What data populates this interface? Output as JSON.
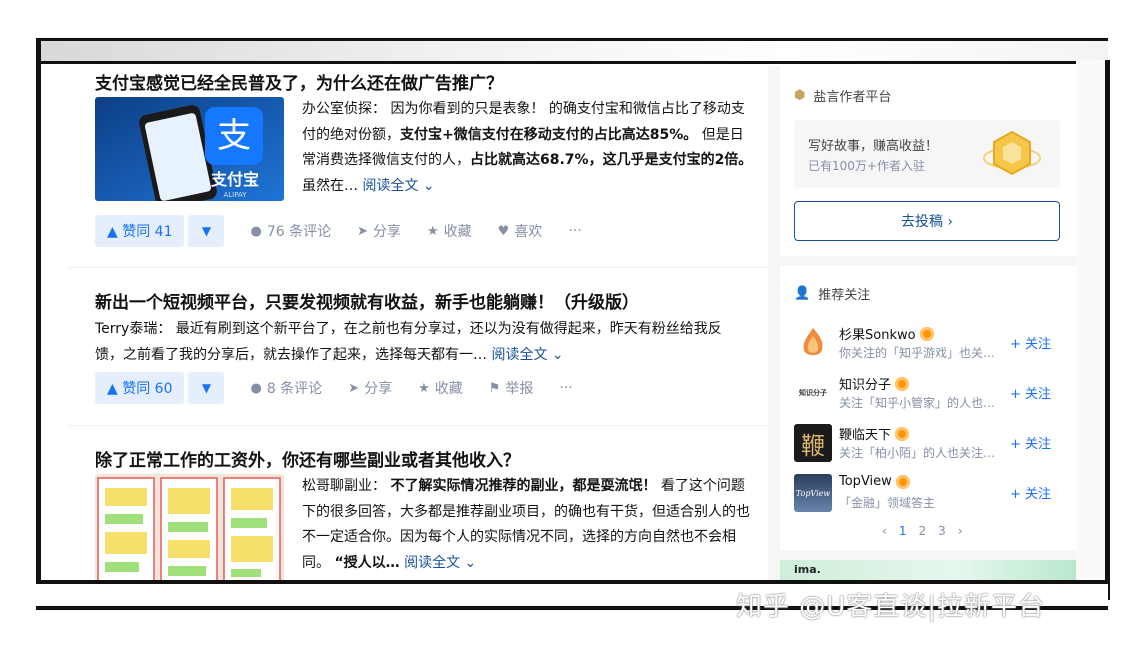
{
  "feed": {
    "cards": [
      {
        "title": "支付宝感觉已经全民普及了，为什么还在做广告推广？",
        "author": "办公室侦探：",
        "excerpt_parts": [
          "因为你看到的只是表象！ 的确支付宝和微信占比了移动支付的绝对份额，",
          "支付宝+微信支付在移动支付的占比高达85%。",
          " 但是日常消费选择微信支付的人，",
          "占比就高达68.7%，这几乎是支付宝的2倍。",
          " 虽然在…"
        ],
        "read_more": "阅读全文 ⌄",
        "thumb_text": "支付宝",
        "thumb_sub": "ALIPAY",
        "upvote": "▲ 赞同 41",
        "downvote": "▼",
        "comments": "76 条评论",
        "share": "分享",
        "favorite": "收藏",
        "like": "喜欢",
        "more": "···"
      },
      {
        "title": "新出一个短视频平台，只要发视频就有收益，新手也能躺赚！（升级版）",
        "author": "Terry泰瑞：",
        "excerpt": "最近有刷到这个新平台了，在之前也有分享过，还以为没有做得起来，昨天有粉丝给我反馈，之前看了我的分享后，就去操作了起来，选择每天都有一…",
        "read_more": "阅读全文 ⌄",
        "upvote": "▲ 赞同 60",
        "downvote": "▼",
        "comments": "8 条评论",
        "share": "分享",
        "favorite": "收藏",
        "report": "举报",
        "more": "···"
      },
      {
        "title": "除了正常工作的工资外，你还有哪些副业或者其他收入？",
        "author": "松哥聊副业：",
        "excerpt_parts": [
          "不了解实际情况推荐的副业，都是耍流氓！",
          " 看了这个问题下的很多回答，大多都是推荐副业项目，的确也有干货，但适合别人的也不一定适合你。因为每个人的实际情况不同，选择的方向自然也不会相同。 ",
          "“授人以…"
        ],
        "read_more": "阅读全文 ⌄"
      }
    ]
  },
  "sidebar": {
    "creator": {
      "title": "盐言作者平台",
      "promo_title": "写好故事，赚高收益！",
      "promo_sub": "已有100万+作者入驻",
      "submit": "去投稿 ›"
    },
    "recommend": {
      "title": "推荐关注",
      "items": [
        {
          "name": "杉果Sonkwo",
          "desc": "你关注的「知乎游戏」也关…",
          "follow": "+ 关注"
        },
        {
          "name": "知识分子",
          "desc": "关注「知乎小管家」的人也…",
          "follow": "+ 关注",
          "logo_text": "知识分子"
        },
        {
          "name": "鞭临天下",
          "desc": "关注「柏小陌」的人也关注…",
          "follow": "+ 关注",
          "logo_text": "鞭"
        },
        {
          "name": "TopView",
          "desc": "「金融」领域答主",
          "follow": "+ 关注",
          "logo_text": "TopView"
        }
      ],
      "pager": [
        "‹",
        "1",
        "2",
        "3",
        "›"
      ]
    },
    "ad": {
      "label": "ima."
    }
  },
  "watermark": "知乎 @U客直谈|拉新平台"
}
